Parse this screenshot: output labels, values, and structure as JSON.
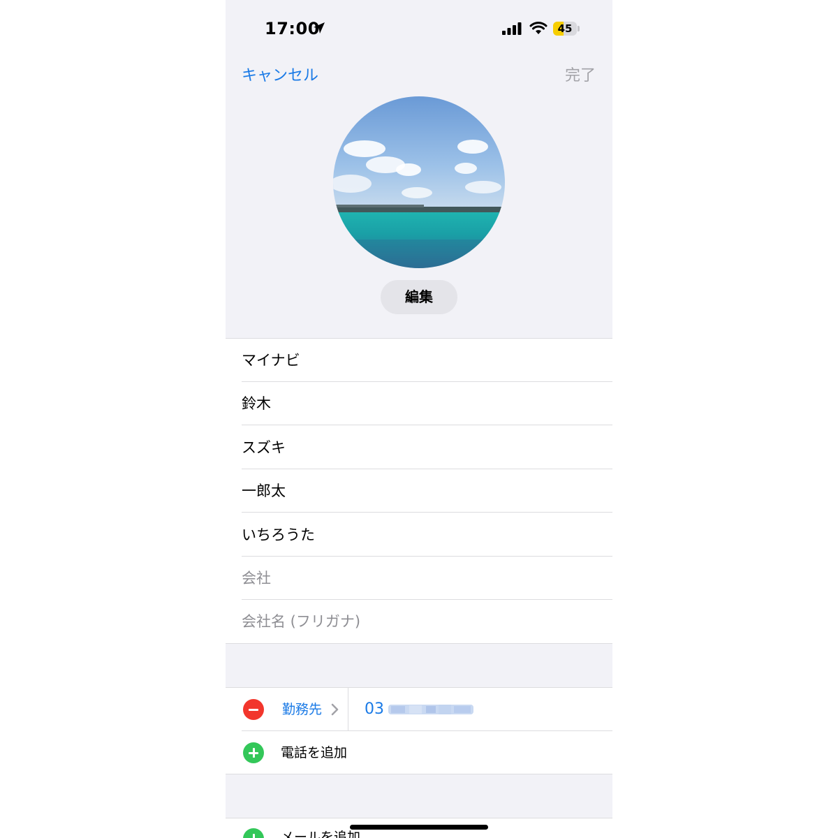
{
  "status_bar": {
    "time": "17:00",
    "battery_level": 45,
    "battery_text": "45",
    "battery_color": "#f7ce00",
    "icons": [
      "location-arrow-icon",
      "cellular-signal-icon",
      "wifi-icon",
      "battery-icon"
    ]
  },
  "nav": {
    "cancel_label": "キャンセル",
    "done_label": "完了"
  },
  "photo": {
    "edit_label": "編集"
  },
  "name_fields": [
    {
      "value": "マイナビ"
    },
    {
      "value": "鈴木"
    },
    {
      "value": "スズキ"
    },
    {
      "value": "一郎太"
    },
    {
      "value": "いちろうた"
    }
  ],
  "company_fields": {
    "company_placeholder": "会社",
    "company_kana_placeholder": "会社名 (フリガナ)"
  },
  "phone": {
    "label": "勤務先",
    "number_visible": "03",
    "add_label": "電話を追加"
  },
  "email": {
    "add_label": "メールを追加"
  },
  "colors": {
    "accent": "#1a7ae6",
    "remove": "#f2362c",
    "add": "#33c759",
    "grouped_background": "#f2f2f7"
  }
}
